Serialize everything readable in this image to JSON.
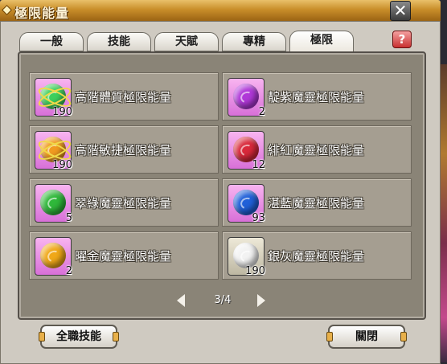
{
  "window": {
    "title": "極限能量",
    "close_label": "✕"
  },
  "tabs": [
    {
      "label": "一般",
      "active": false
    },
    {
      "label": "技能",
      "active": false
    },
    {
      "label": "天賦",
      "active": false
    },
    {
      "label": "專精",
      "active": false
    },
    {
      "label": "極限",
      "active": true
    }
  ],
  "help_label": "?",
  "items": [
    {
      "label": "高階體質極限能量",
      "count": "190",
      "orb": "#3ecf5c",
      "ring": true
    },
    {
      "label": "靛紫魔靈極限能量",
      "count": "2",
      "orb": "#b038d8",
      "ring": false
    },
    {
      "label": "高階敏捷極限能量",
      "count": "190",
      "orb": "#f09a20",
      "ring": true
    },
    {
      "label": "緋紅魔靈極限能量",
      "count": "12",
      "orb": "#d8283a",
      "ring": false
    },
    {
      "label": "翠綠魔靈極限能量",
      "count": "5",
      "orb": "#2fb83a",
      "ring": false
    },
    {
      "label": "湛藍魔靈極限能量",
      "count": "93",
      "orb": "#2060d8",
      "ring": false
    },
    {
      "label": "曜金魔靈極限能量",
      "count": "2",
      "orb": "#f0a818",
      "ring": false
    },
    {
      "label": "銀灰魔靈極限能量",
      "count": "190",
      "orb": "#f2f2f2",
      "ring": false
    }
  ],
  "pager": {
    "text": "3/4"
  },
  "buttons": {
    "all_skills": "全職技能",
    "close": "關閉"
  }
}
